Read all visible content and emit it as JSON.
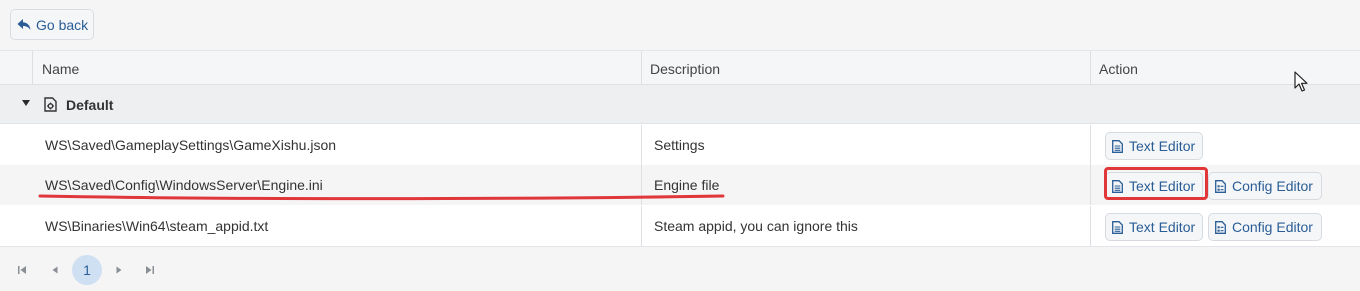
{
  "toolbar": {
    "go_back_label": "Go back"
  },
  "table": {
    "columns": {
      "name": "Name",
      "description": "Description",
      "action": "Action"
    },
    "group": {
      "label": "Default"
    },
    "rows": [
      {
        "name": "WS\\Saved\\GameplaySettings\\GameXishu.json",
        "description": "Settings",
        "text_editor": "Text Editor"
      },
      {
        "name": "WS\\Saved\\Config\\WindowsServer\\Engine.ini",
        "description": "Engine file",
        "text_editor": "Text Editor",
        "config_editor": "Config Editor"
      },
      {
        "name": "WS\\Binaries\\Win64\\steam_appid.txt",
        "description": "Steam appid, you can ignore this",
        "text_editor": "Text Editor",
        "config_editor": "Config Editor"
      }
    ]
  },
  "pager": {
    "current_page": "1"
  },
  "colors": {
    "accent": "#2a5d96",
    "annotation": "#e0373b",
    "page_active_bg": "#cfe0f2"
  }
}
